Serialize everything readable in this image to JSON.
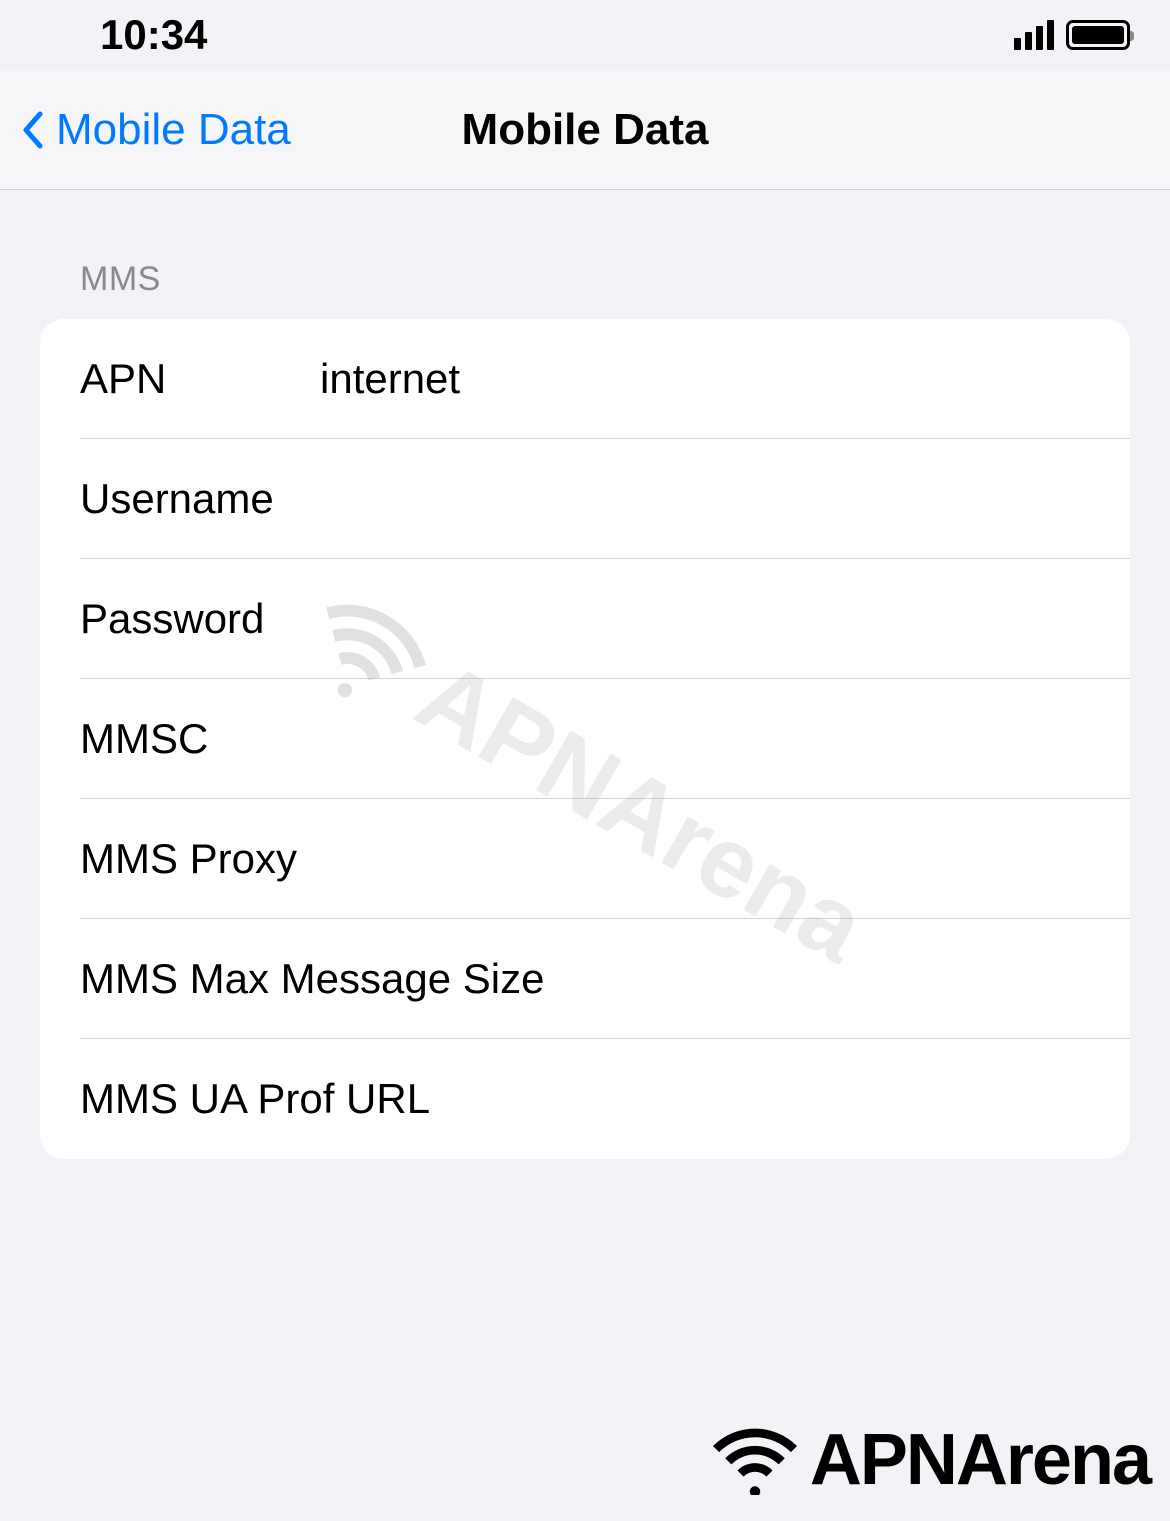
{
  "statusbar": {
    "time": "10:34"
  },
  "navbar": {
    "back_label": "Mobile Data",
    "title": "Mobile Data"
  },
  "section": {
    "header": "MMS",
    "rows": [
      {
        "label": "APN",
        "value": "internet"
      },
      {
        "label": "Username",
        "value": ""
      },
      {
        "label": "Password",
        "value": ""
      },
      {
        "label": "MMSC",
        "value": ""
      },
      {
        "label": "MMS Proxy",
        "value": ""
      },
      {
        "label": "MMS Max Message Size",
        "value": ""
      },
      {
        "label": "MMS UA Prof URL",
        "value": ""
      }
    ]
  },
  "watermark": {
    "text": "APNArena"
  },
  "brand": {
    "text": "APNArena"
  }
}
